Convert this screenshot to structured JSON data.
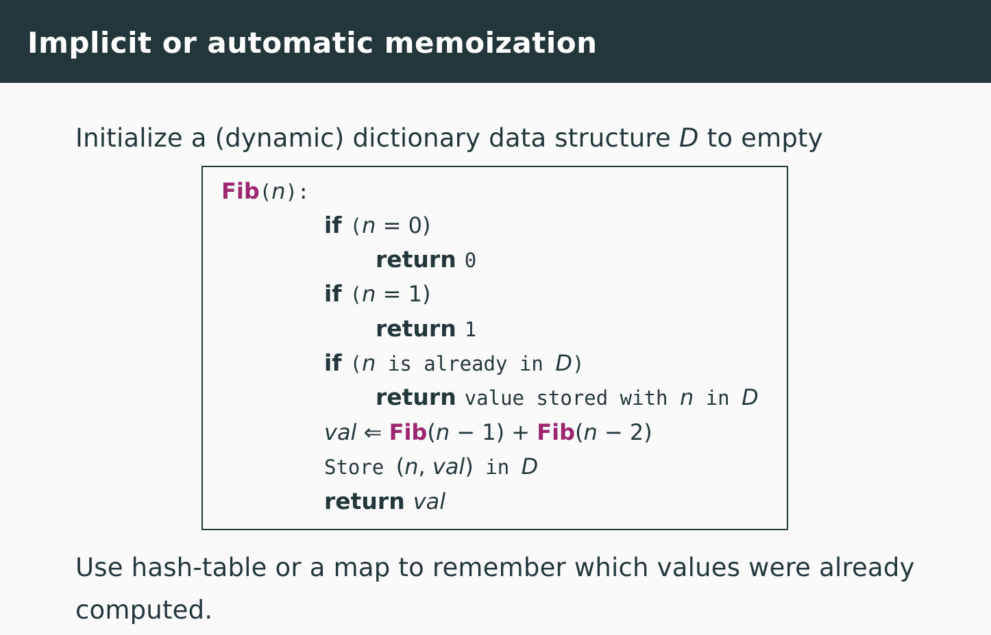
{
  "slide": {
    "title": "Implicit or automatic memoization",
    "intro_prefix": "Initialize a (dynamic) dictionary data structure ",
    "intro_var": "D",
    "intro_suffix": " to empty",
    "outro": "Use hash-table or a map to remember which values were already computed."
  },
  "code": {
    "fn_name": "Fib",
    "fn_open": "(",
    "fn_param": "n",
    "fn_close": "):",
    "line1": {
      "kw": "if",
      "pre": "(",
      "var": "n",
      "rest": " = 0)"
    },
    "line2": {
      "kw": "return",
      "value": "0"
    },
    "line3": {
      "kw": "if",
      "pre": "(",
      "var": "n",
      "rest": " = 1)"
    },
    "line4": {
      "kw": "return",
      "value": "1"
    },
    "line5": {
      "kw": "if",
      "pre": "(",
      "var": "n",
      "mid": " is already in ",
      "var2": "D",
      "close": ")"
    },
    "line6": {
      "kw": "return",
      "text": "value stored with ",
      "var": "n",
      "mid": " in ",
      "var2": "D"
    },
    "line7": {
      "var": "val",
      "arrow": " ⇐ ",
      "fn1": "Fib",
      "args1_open": "(",
      "args1_var": "n",
      "args1_rest": " − 1)",
      "plus": " + ",
      "fn2": "Fib",
      "args2_open": "(",
      "args2_var": "n",
      "args2_rest": " − 2)"
    },
    "line8": {
      "text": "Store ",
      "open": "(",
      "var1": "n",
      "comma": ", ",
      "var2": "val",
      "close": ")",
      "mid": " in ",
      "var3": "D"
    },
    "line9": {
      "kw": "return",
      "var": "val"
    }
  },
  "colors": {
    "header_bg": "#23373b",
    "text": "#23373b",
    "function_name": "#9c2770",
    "background": "#fafafa"
  }
}
